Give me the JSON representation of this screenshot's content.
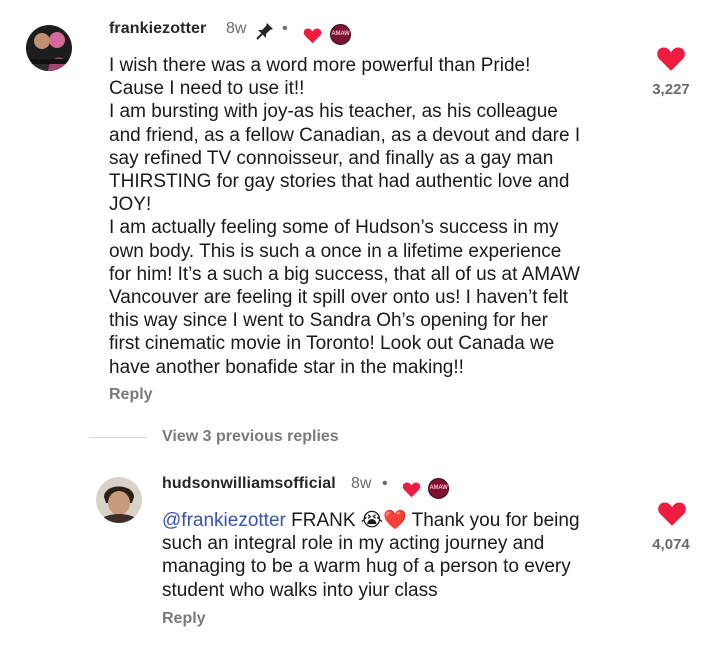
{
  "comments": [
    {
      "username": "frankiezotter",
      "time": "8w",
      "pinned_icon": "pin-icon",
      "dot": "•",
      "badge_text": "AMAW",
      "lines": [
        "I wish there was a word more powerful than Pride!",
        "Cause I  need to use it!!",
        "I am bursting with joy-as his teacher, as his colleague",
        "and friend, as a fellow Canadian, as a devout and dare I",
        "say refined TV connoisseur, and finally as a gay man",
        "THIRSTING for gay stories that had authentic love and",
        "JOY!",
        "I am actually feeling some of Hudson’s success in my",
        "own body. This is such a once in a lifetime experience",
        "for him! It’s a such a big success, that all of us at AMAW",
        "Vancouver are feeling it spill over onto us! I haven’t felt",
        "this way since I went to Sandra Oh’s opening for her",
        "first cinematic movie in Toronto! Look out Canada we",
        "have another bonafide star in the making!!"
      ],
      "reply_label": "Reply",
      "like_count": "3,227"
    },
    {
      "username": "hudsonwilliamsofficial",
      "time": "8w",
      "dot": "•",
      "badge_text": "AMAW",
      "mention": "@frankiezotter",
      "line1_rest": " FRANK 😭❤️ Thank you for being",
      "lines": [
        "such an integral role in my acting journey and",
        "managing to be a warm hug of a person to every",
        "student who walks into yiur class"
      ],
      "reply_label": "Reply",
      "like_count": "4,074"
    }
  ],
  "view_replies_label": "View 3 previous replies",
  "colors": {
    "heart": "#ed1c40",
    "mention": "#3852b0",
    "badge": "#7a1230"
  }
}
